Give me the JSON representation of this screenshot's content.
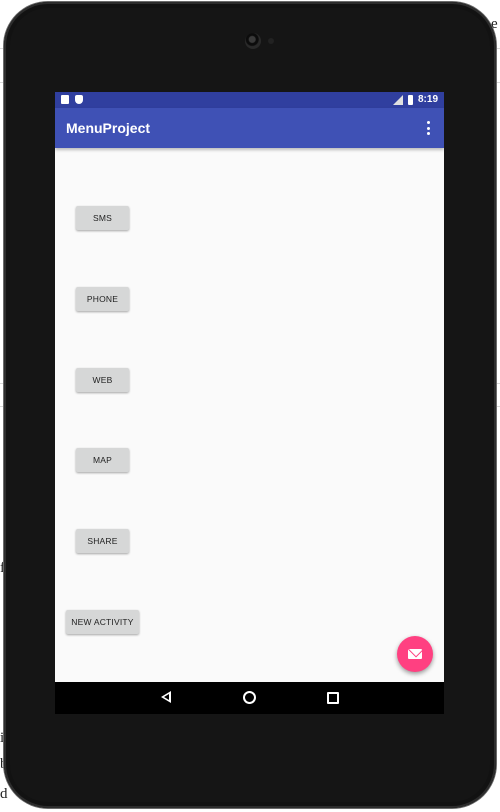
{
  "background": {
    "fragment_top_right": "e",
    "fragment_mid_left": "f",
    "fragment_bottom_1": "i",
    "fragment_bottom_2": "b",
    "fragment_bottom_3": "d"
  },
  "status_bar": {
    "time": "8:19",
    "icons": [
      "sd-card-icon",
      "android-icon",
      "signal-icon",
      "battery-icon"
    ],
    "color": "#303f9f"
  },
  "app_bar": {
    "title": "MenuProject",
    "overflow_icon": "more-vert-icon",
    "color": "#3f51b5"
  },
  "buttons": {
    "sms": "SMS",
    "phone": "PHONE",
    "web": "WEB",
    "map": "MAP",
    "share": "SHARE",
    "new_activity": "NEW ACTIVITY"
  },
  "fab": {
    "icon": "email-icon",
    "color": "#ff4081"
  },
  "nav_bar": {
    "icons": [
      "back-icon",
      "home-icon",
      "recents-icon"
    ]
  }
}
